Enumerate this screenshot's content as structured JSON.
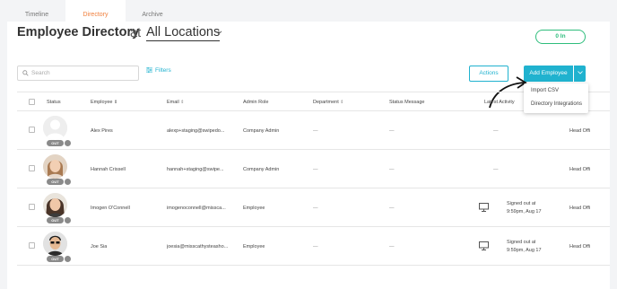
{
  "tabs": [
    {
      "label": "Timeline"
    },
    {
      "label": "Directory",
      "active": true
    },
    {
      "label": "Archive"
    }
  ],
  "header": {
    "title": "Employee Directory",
    "at": "at",
    "location": "All Locations",
    "in_label": "0 In"
  },
  "toolbar": {
    "search_placeholder": "Search",
    "filters_label": "Filters",
    "actions_label": "Actions",
    "add_employee_label": "Add Employee"
  },
  "dropdown": {
    "items": [
      "Import CSV",
      "Directory Integrations"
    ]
  },
  "table": {
    "columns": [
      "Status",
      "Employee",
      "Email",
      "Admin Role",
      "Department",
      "Status Message",
      "Latest Activity"
    ],
    "rows": [
      {
        "status": "OUT",
        "name": "Alex Pires",
        "email": "alexp+staging@swipedo...",
        "role": "Company Admin",
        "department": "—",
        "status_message": "—",
        "activity": "—",
        "activity_line2": "",
        "location": "Head Offi"
      },
      {
        "status": "OUT",
        "name": "Hannah Crissell",
        "email": "hannah+staging@swipe...",
        "role": "Company Admin",
        "department": "—",
        "status_message": "—",
        "activity": "—",
        "activity_line2": "",
        "location": "Head Offi"
      },
      {
        "status": "OUT",
        "name": "Imogen O'Connell",
        "email": "imogenoconnell@missca...",
        "role": "Employee",
        "department": "—",
        "status_message": "—",
        "activity": "Signed out at",
        "activity_line2": "9:59pm, Aug 17",
        "location": "Head Offi"
      },
      {
        "status": "OUT",
        "name": "Joe Sia",
        "email": "joesia@misscathysteasho...",
        "role": "Employee",
        "department": "—",
        "status_message": "—",
        "activity": "Signed out at",
        "activity_line2": "9:59pm, Aug 17",
        "location": "Head Offi"
      }
    ]
  },
  "colors": {
    "accent": "#20b2cf",
    "active_tab": "#f07f3c",
    "in_green": "#2ebd7c",
    "out_badge": "#8a8a8a"
  }
}
